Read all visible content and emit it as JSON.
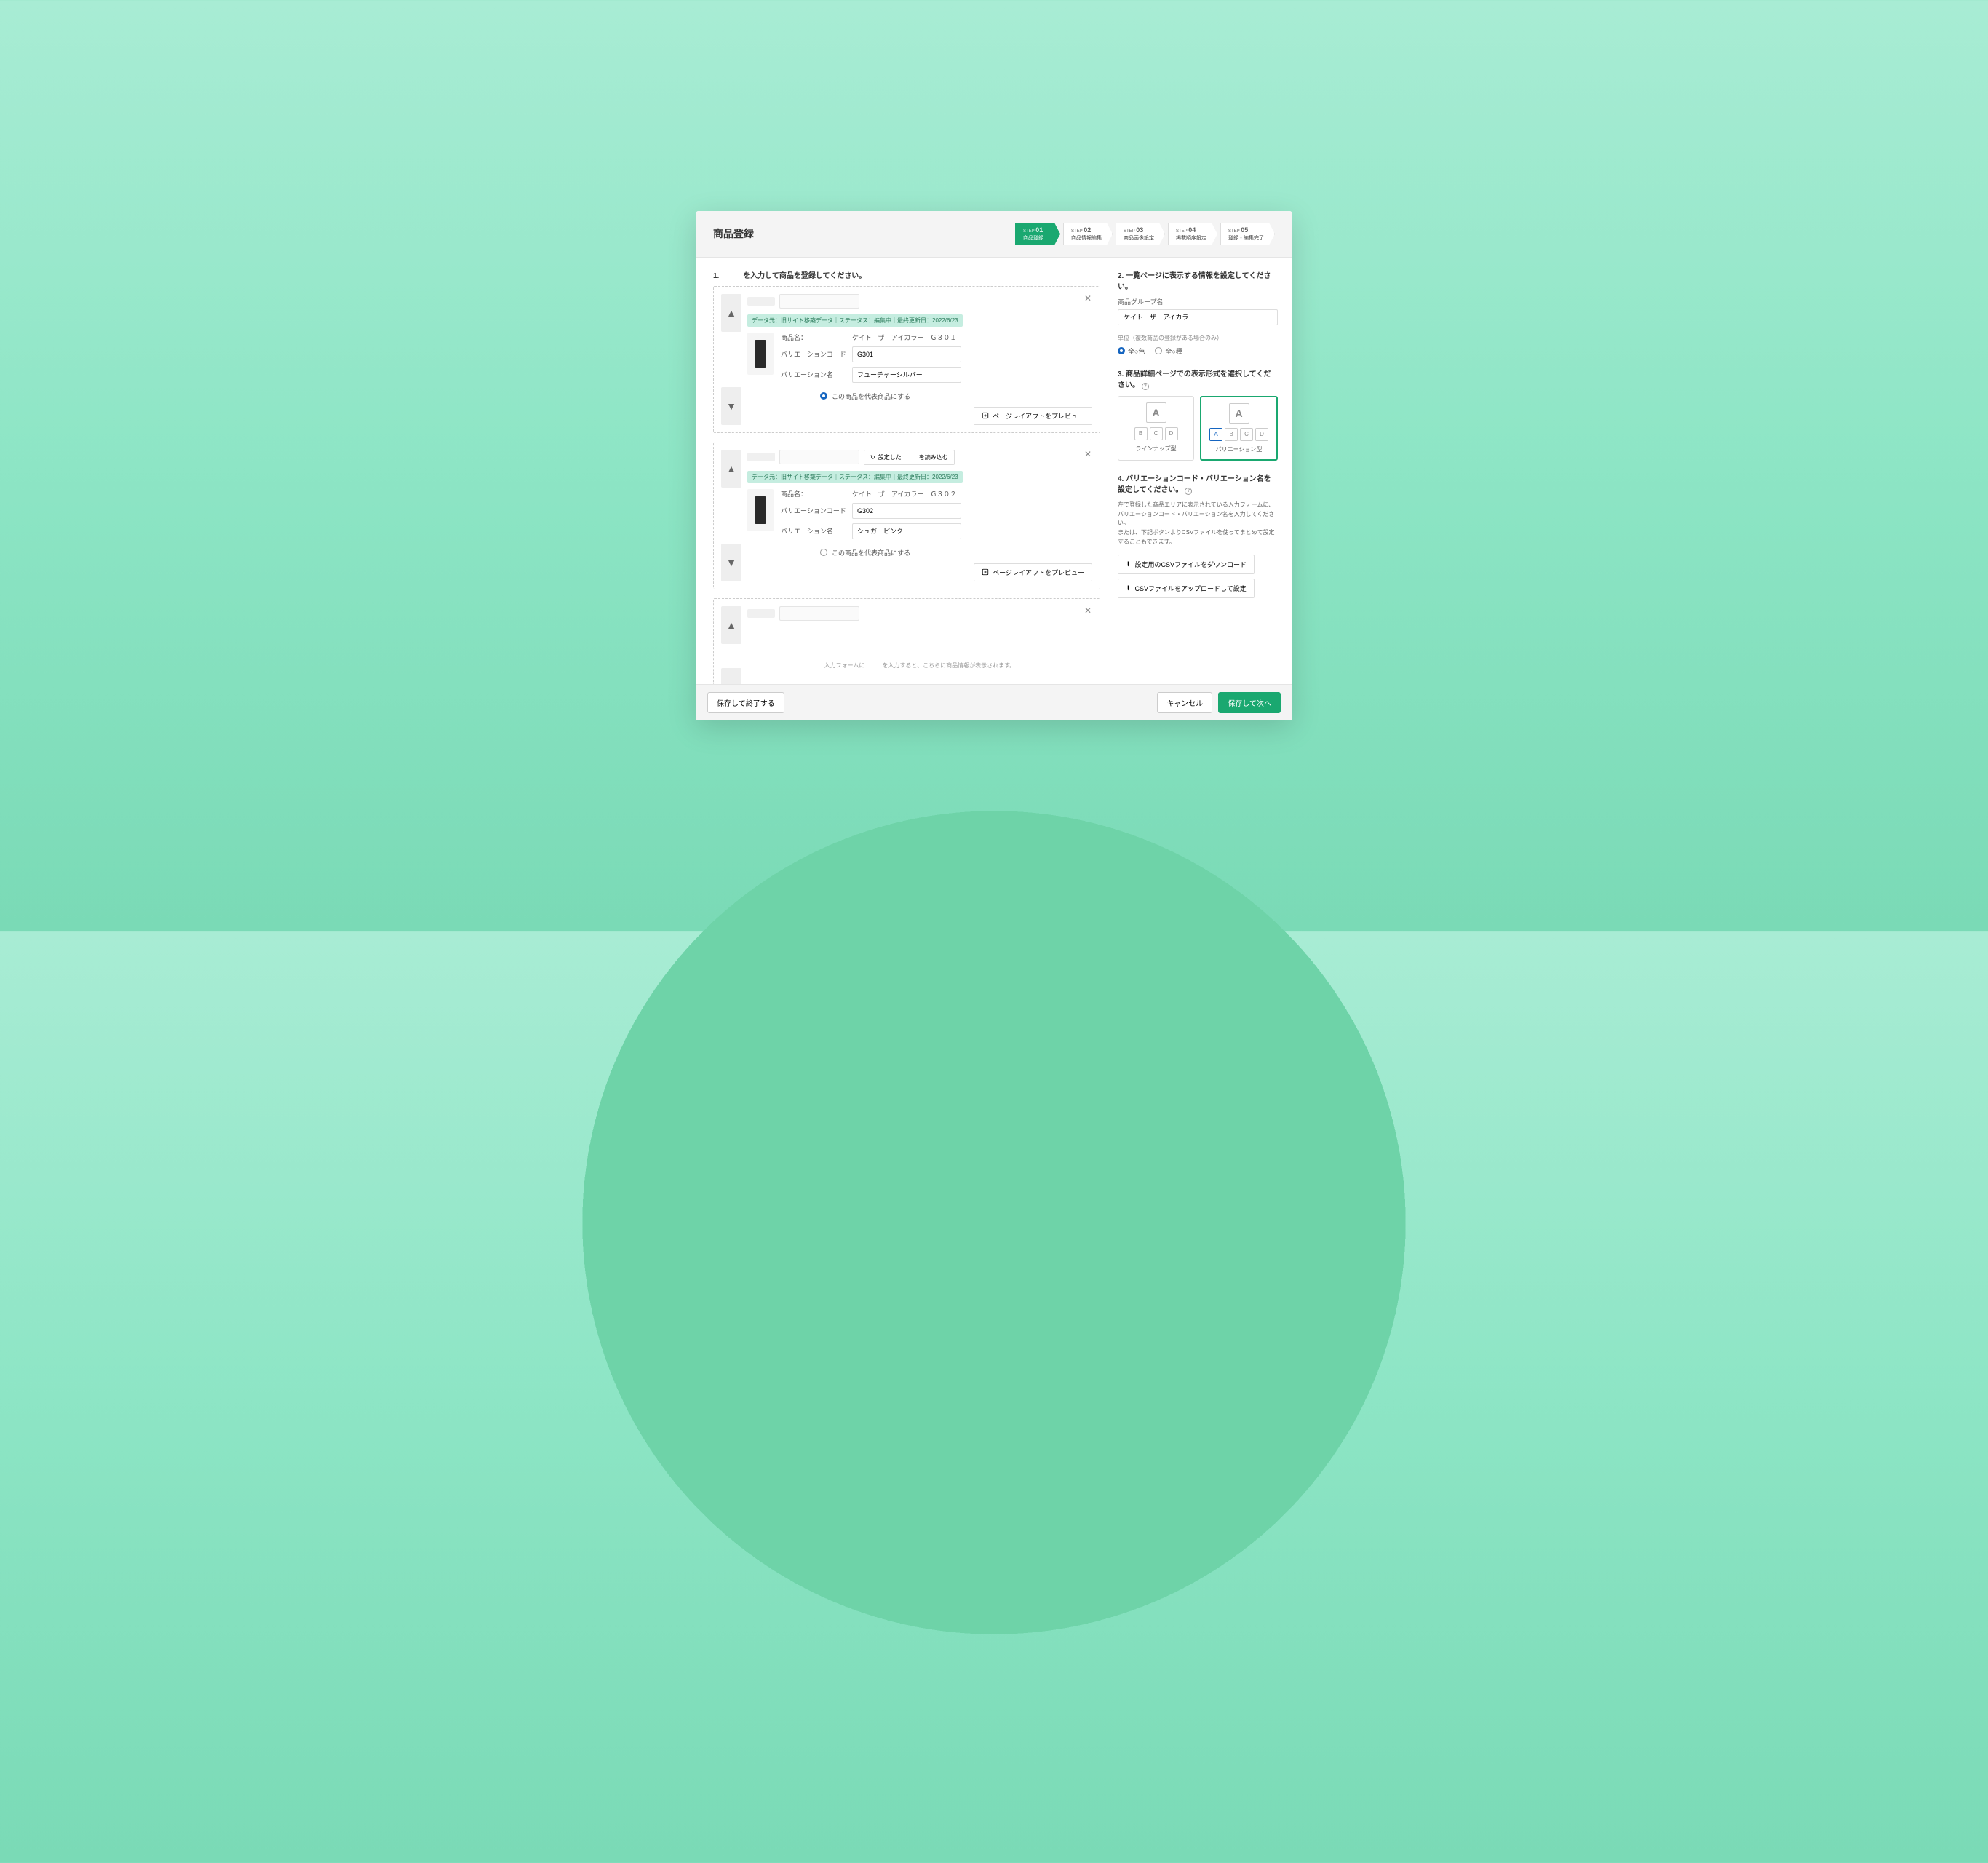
{
  "header": {
    "title": "商品登録"
  },
  "steps": [
    {
      "num": "01",
      "label": "商品登録",
      "active": true
    },
    {
      "num": "02",
      "label": "商品情報編集"
    },
    {
      "num": "03",
      "label": "商品画像設定"
    },
    {
      "num": "04",
      "label": "掲載順序設定"
    },
    {
      "num": "05",
      "label": "登録・編集完了"
    }
  ],
  "left": {
    "title": "1. 　　　を入力して商品を登録してください。",
    "reload": "設定した　　　を読み込む",
    "meta": "データ元：旧サイト移築データ｜ステータス：編集中｜最終更新日：2022/6/23",
    "labels": {
      "name": "商品名：",
      "varcode": "バリエーションコード",
      "varname": "バリエーション名"
    },
    "radio_label": "この商品を代表商品にする",
    "preview": "ページレイアウトをプレビュー",
    "empty": "入力フォームに　　　を入力すると、こちらに商品情報が表示されます。",
    "p1": {
      "name": "ケイト　ザ　アイカラー　Ｇ３０１",
      "code": "G301",
      "varname": "フューチャーシルバー"
    },
    "p2": {
      "name": "ケイト　ザ　アイカラー　Ｇ３０２",
      "code": "G302",
      "varname": "シュガーピンク"
    }
  },
  "right": {
    "t2": "2. 一覧ページに表示する情報を設定してください。",
    "group_label": "商品グループ名",
    "group_val": "ケイト　ザ　アイカラー",
    "unit_label": "単位（複数商品の登録がある場合のみ）",
    "unit1": "全○色",
    "unit2": "全○種",
    "t3": "3. 商品詳細ページでの表示形式を選択してください。",
    "layout1": "ラインナップ型",
    "layout2": "バリエーション型",
    "t4": "4. バリエーションコード・バリエーション名を設定してください。",
    "desc": "左で登録した商品エリアに表示されている入力フォームに、バリエーションコード・バリエーション名を入力してください。\nまたは、下記ボタンよりCSVファイルを使ってまとめて設定することもできます。",
    "dl": "設定用のCSVファイルをダウンロード",
    "ul": "CSVファイルをアップロードして設定"
  },
  "footer": {
    "save_exit": "保存して終了する",
    "cancel": "キャンセル",
    "next": "保存して次へ"
  }
}
